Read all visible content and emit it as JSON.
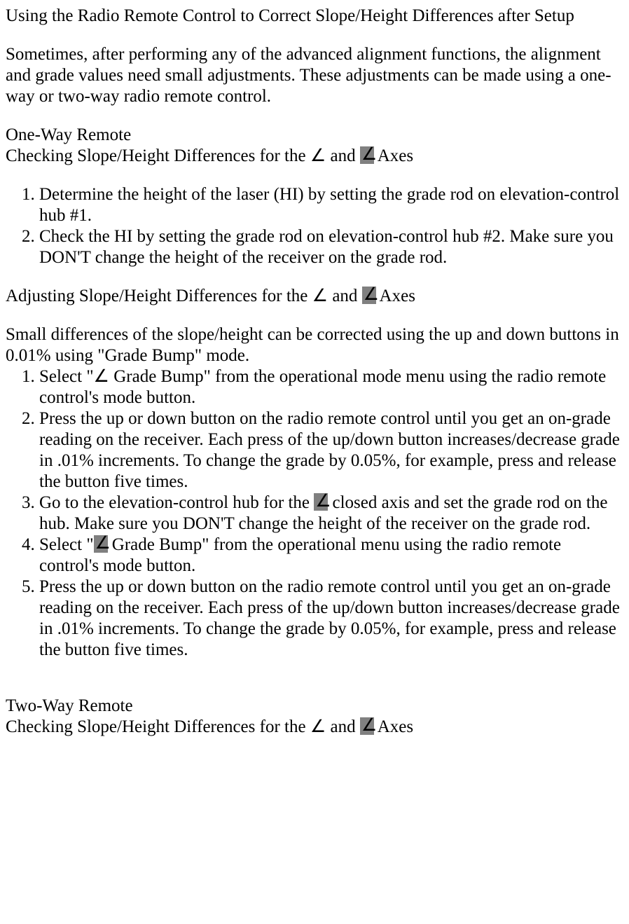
{
  "title": "Using the Radio Remote Control to Correct Slope/Height Differences after Setup",
  "intro": "Sometimes, after performing any of the advanced alignment functions, the alignment and grade values need small adjustments. These adjustments can be made using a one-way or two-way radio remote control.",
  "section1_heading": "One-Way Remote",
  "sub_check_a": "Checking Slope/Height Differences for the ",
  "sub_check_symbol1": "∠",
  "sub_check_and": " and ",
  "sub_check_b": " Axes",
  "check_list": [
    "Determine the height of the laser (HI) by setting the grade rod on elevation-control hub #1.",
    "Check the HI by setting the grade rod on elevation-control hub #2. Make sure you DON'T change the height of the receiver on the grade rod."
  ],
  "sub_adjust_a": "Adjusting Slope/Height Differences for the ",
  "sub_adjust_symbol1": "∠",
  "sub_adjust_and": " and ",
  "sub_adjust_b": " Axes",
  "adjust_intro": "Small differences of the slope/height can be corrected using the up and down buttons in 0.01% using \"Grade Bump\" mode.",
  "adjust_list": {
    "item1_a": "Select \"",
    "item1_symbol": "∠",
    "item1_b": " Grade Bump\" from the operational mode menu using the radio remote control's mode button.",
    "item2": "Press the up or down button on the radio remote control until you get an on-grade reading on the receiver. Each press of the up/down button increases/decrease grade in .01% increments. To change the grade by 0.05%, for example, press and release the button five times.",
    "item3_a": "Go to the elevation-control hub for the ",
    "item3_b": " closed axis and set the grade rod on the hub. Make sure you DON'T change the height of the receiver on the grade rod.",
    "item4_a": "Select \"",
    "item4_b": " Grade Bump\" from the operational menu using the radio remote control's mode button.",
    "item5": "Press the up or down button on the radio remote control until you get an on-grade reading on the receiver. Each press of the up/down button increases/decrease grade in .01% increments. To change the grade by 0.05%, for example, press and release the button five times."
  },
  "section2_heading": "Two-Way Remote",
  "sub2_check_a": "Checking Slope/Height Differences for the ",
  "sub2_symbol1": "∠",
  "sub2_and": " and ",
  "sub2_check_b": " Axes"
}
